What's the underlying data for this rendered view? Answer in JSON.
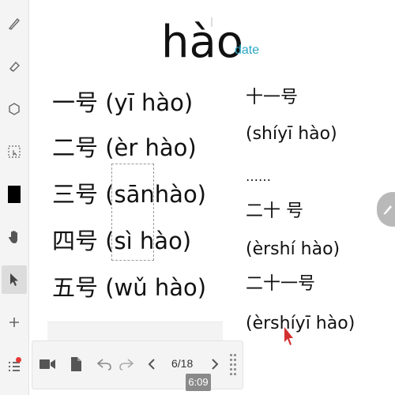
{
  "toolbar": {
    "tools": [
      {
        "name": "pen-icon"
      },
      {
        "name": "eraser-icon"
      },
      {
        "name": "shape-icon"
      },
      {
        "name": "select-box-icon"
      },
      {
        "name": "color-swatch",
        "color": "#000000"
      },
      {
        "name": "hand-pan-icon"
      },
      {
        "name": "pointer-icon",
        "selected": true
      },
      {
        "name": "add-icon"
      },
      {
        "name": "list-icon"
      }
    ]
  },
  "slide": {
    "title": "hào",
    "date_label": "date",
    "left_lines": [
      "一号 (yī hào)",
      "二号 (èr hào)",
      "三号 (sānhào)",
      "四号 (sì hào)",
      "五号 (wǔ hào)"
    ],
    "right_lines": [
      "十一号",
      "(shíyī  hào)",
      "……",
      "二十 号",
      "(èrshí hào)",
      "二十一号",
      "(èrshíyī hào)"
    ]
  },
  "nav": {
    "page_indicator": "6/18",
    "timer": "6:09"
  },
  "colors": {
    "accent": "#2aa6c6",
    "badge": "#e53935",
    "pointer": "#d32f2f"
  }
}
